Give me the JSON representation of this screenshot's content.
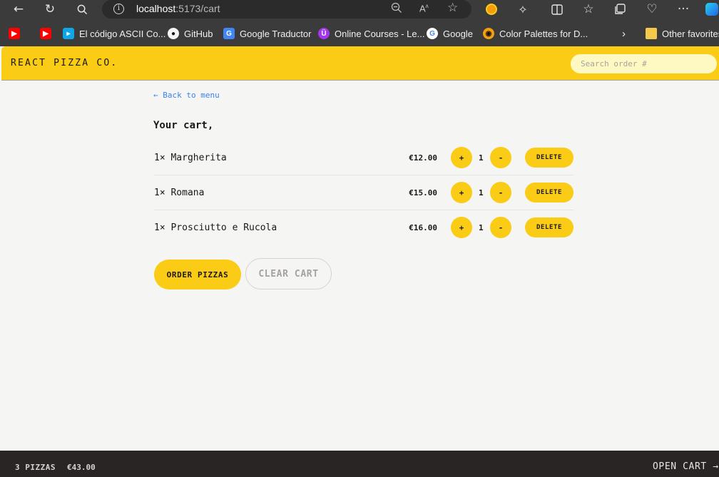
{
  "browser": {
    "url_host": "localhost",
    "url_path": ":5173/cart",
    "bookmarks": [
      {
        "label": "",
        "icon": "youtube-icon"
      },
      {
        "label": "",
        "icon": "youtube-icon"
      },
      {
        "label": "El código ASCII Co...",
        "icon": "ascii-icon"
      },
      {
        "label": "GitHub",
        "icon": "github-icon"
      },
      {
        "label": "Google Traductor",
        "icon": "translate-icon"
      },
      {
        "label": "Online Courses - Le...",
        "icon": "udemy-icon"
      },
      {
        "label": "Google",
        "icon": "google-icon"
      },
      {
        "label": "Color Palettes for D...",
        "icon": "palette-icon"
      },
      {
        "label": "Other favorites",
        "icon": "folder-icon"
      }
    ]
  },
  "header": {
    "logo": "REACT PIZZA CO.",
    "search_placeholder": "Search order #"
  },
  "cart": {
    "back_link": "← Back to menu",
    "title": "Your cart,",
    "items": [
      {
        "name": "1× Margherita",
        "price": "€12.00",
        "quantity": "1",
        "inc_label": "+",
        "dec_label": "-",
        "delete_label": "DELETE"
      },
      {
        "name": "1× Romana",
        "price": "€15.00",
        "quantity": "1",
        "inc_label": "+",
        "dec_label": "-",
        "delete_label": "DELETE"
      },
      {
        "name": "1× Prosciutto e Rucola",
        "price": "€16.00",
        "quantity": "1",
        "inc_label": "+",
        "dec_label": "-",
        "delete_label": "DELETE"
      }
    ],
    "order_button": "ORDER PIZZAS",
    "clear_button": "CLEAR CART"
  },
  "footer": {
    "count": "3 PIZZAS",
    "total": "€43.00",
    "open_cart": "OPEN CART →"
  },
  "colors": {
    "accent": "#facc15",
    "footer_bg": "#292524",
    "link": "#3b82f6",
    "background": "#f5f5f4"
  }
}
